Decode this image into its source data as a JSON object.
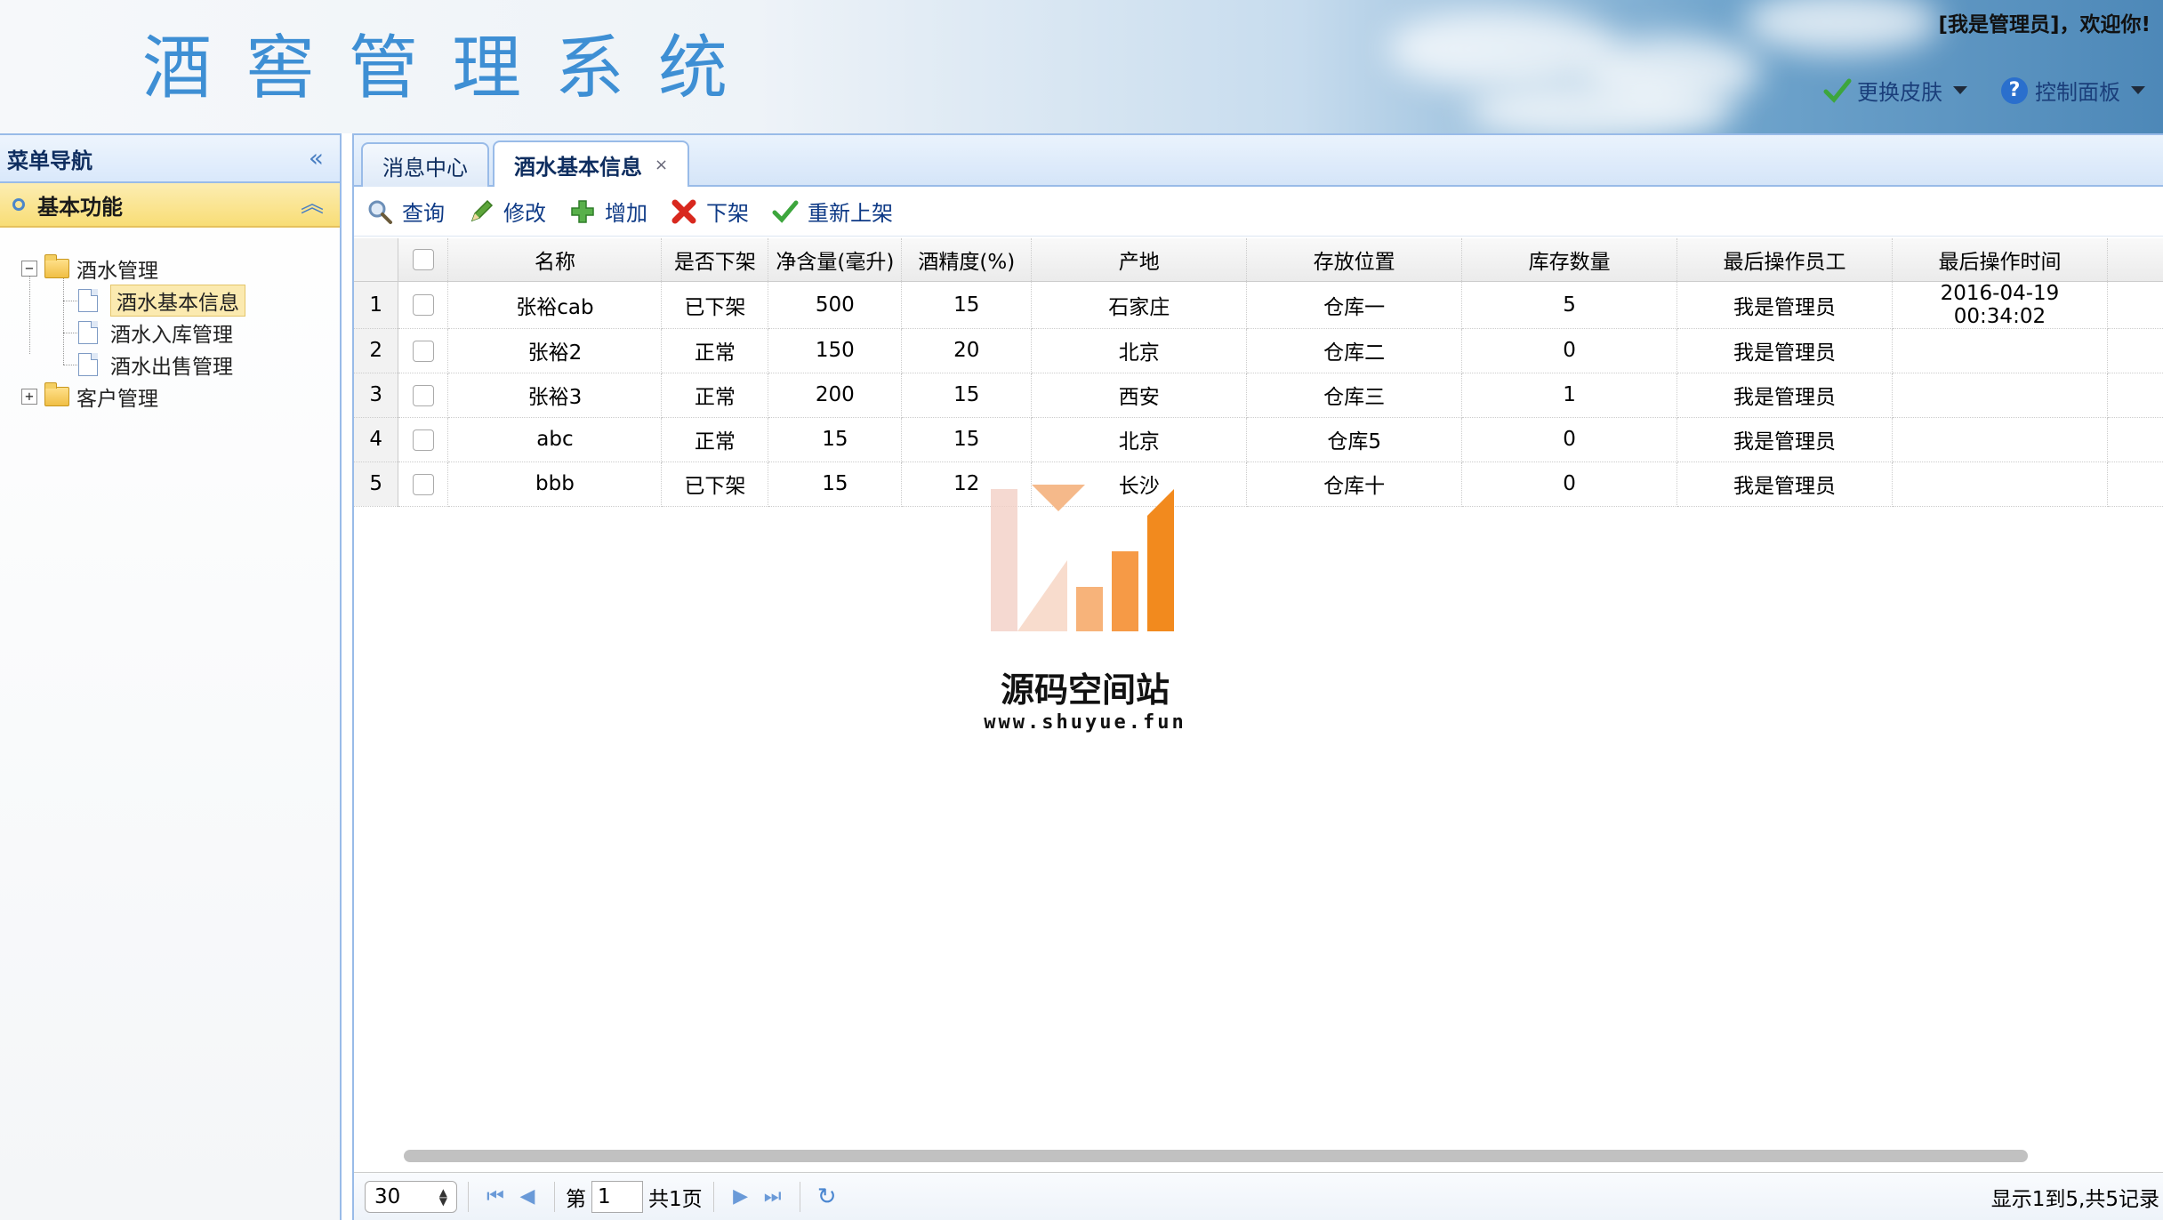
{
  "header": {
    "title": "酒窖管理系统",
    "welcome": "[我是管理员]，欢迎你!",
    "skin_label": "更换皮肤",
    "panel_label": "控制面板"
  },
  "sidebar": {
    "title": "菜单导航",
    "section": "基本功能",
    "tree": {
      "group1": "酒水管理",
      "items": [
        "酒水基本信息",
        "酒水入库管理",
        "酒水出售管理"
      ],
      "group2": "客户管理"
    }
  },
  "tabs": [
    {
      "label": "消息中心"
    },
    {
      "label": "酒水基本信息",
      "active": true
    }
  ],
  "toolbar": {
    "query": "查询",
    "edit": "修改",
    "add": "增加",
    "remove": "下架",
    "relist": "重新上架"
  },
  "grid": {
    "columns": [
      "名称",
      "是否下架",
      "净含量(毫升)",
      "酒精度(%)",
      "产地",
      "存放位置",
      "库存数量",
      "最后操作员工",
      "最后操作时间"
    ],
    "rows": [
      [
        "1",
        "张裕cab",
        "已下架",
        "500",
        "15",
        "石家庄",
        "仓库一",
        "5",
        "我是管理员",
        "2016-04-19 00:34:02"
      ],
      [
        "2",
        "张裕2",
        "正常",
        "150",
        "20",
        "北京",
        "仓库二",
        "0",
        "我是管理员",
        ""
      ],
      [
        "3",
        "张裕3",
        "正常",
        "200",
        "15",
        "西安",
        "仓库三",
        "1",
        "我是管理员",
        ""
      ],
      [
        "4",
        "abc",
        "正常",
        "15",
        "15",
        "北京",
        "仓库5",
        "0",
        "我是管理员",
        ""
      ],
      [
        "5",
        "bbb",
        "已下架",
        "15",
        "12",
        "长沙",
        "仓库十",
        "0",
        "我是管理员",
        ""
      ]
    ]
  },
  "pager": {
    "page_size": "30",
    "page_prefix": "第",
    "page_value": "1",
    "page_total": "共1页",
    "info": "显示1到5,共5记录"
  },
  "watermark": {
    "name": "源码空间站",
    "url": "www.shuyue.fun"
  },
  "colors": {
    "title_blue": "#3e8fd4",
    "border_blue": "#99bbe8",
    "section_yellow": "#f8dd76",
    "link_blue": "#0e3a86"
  }
}
